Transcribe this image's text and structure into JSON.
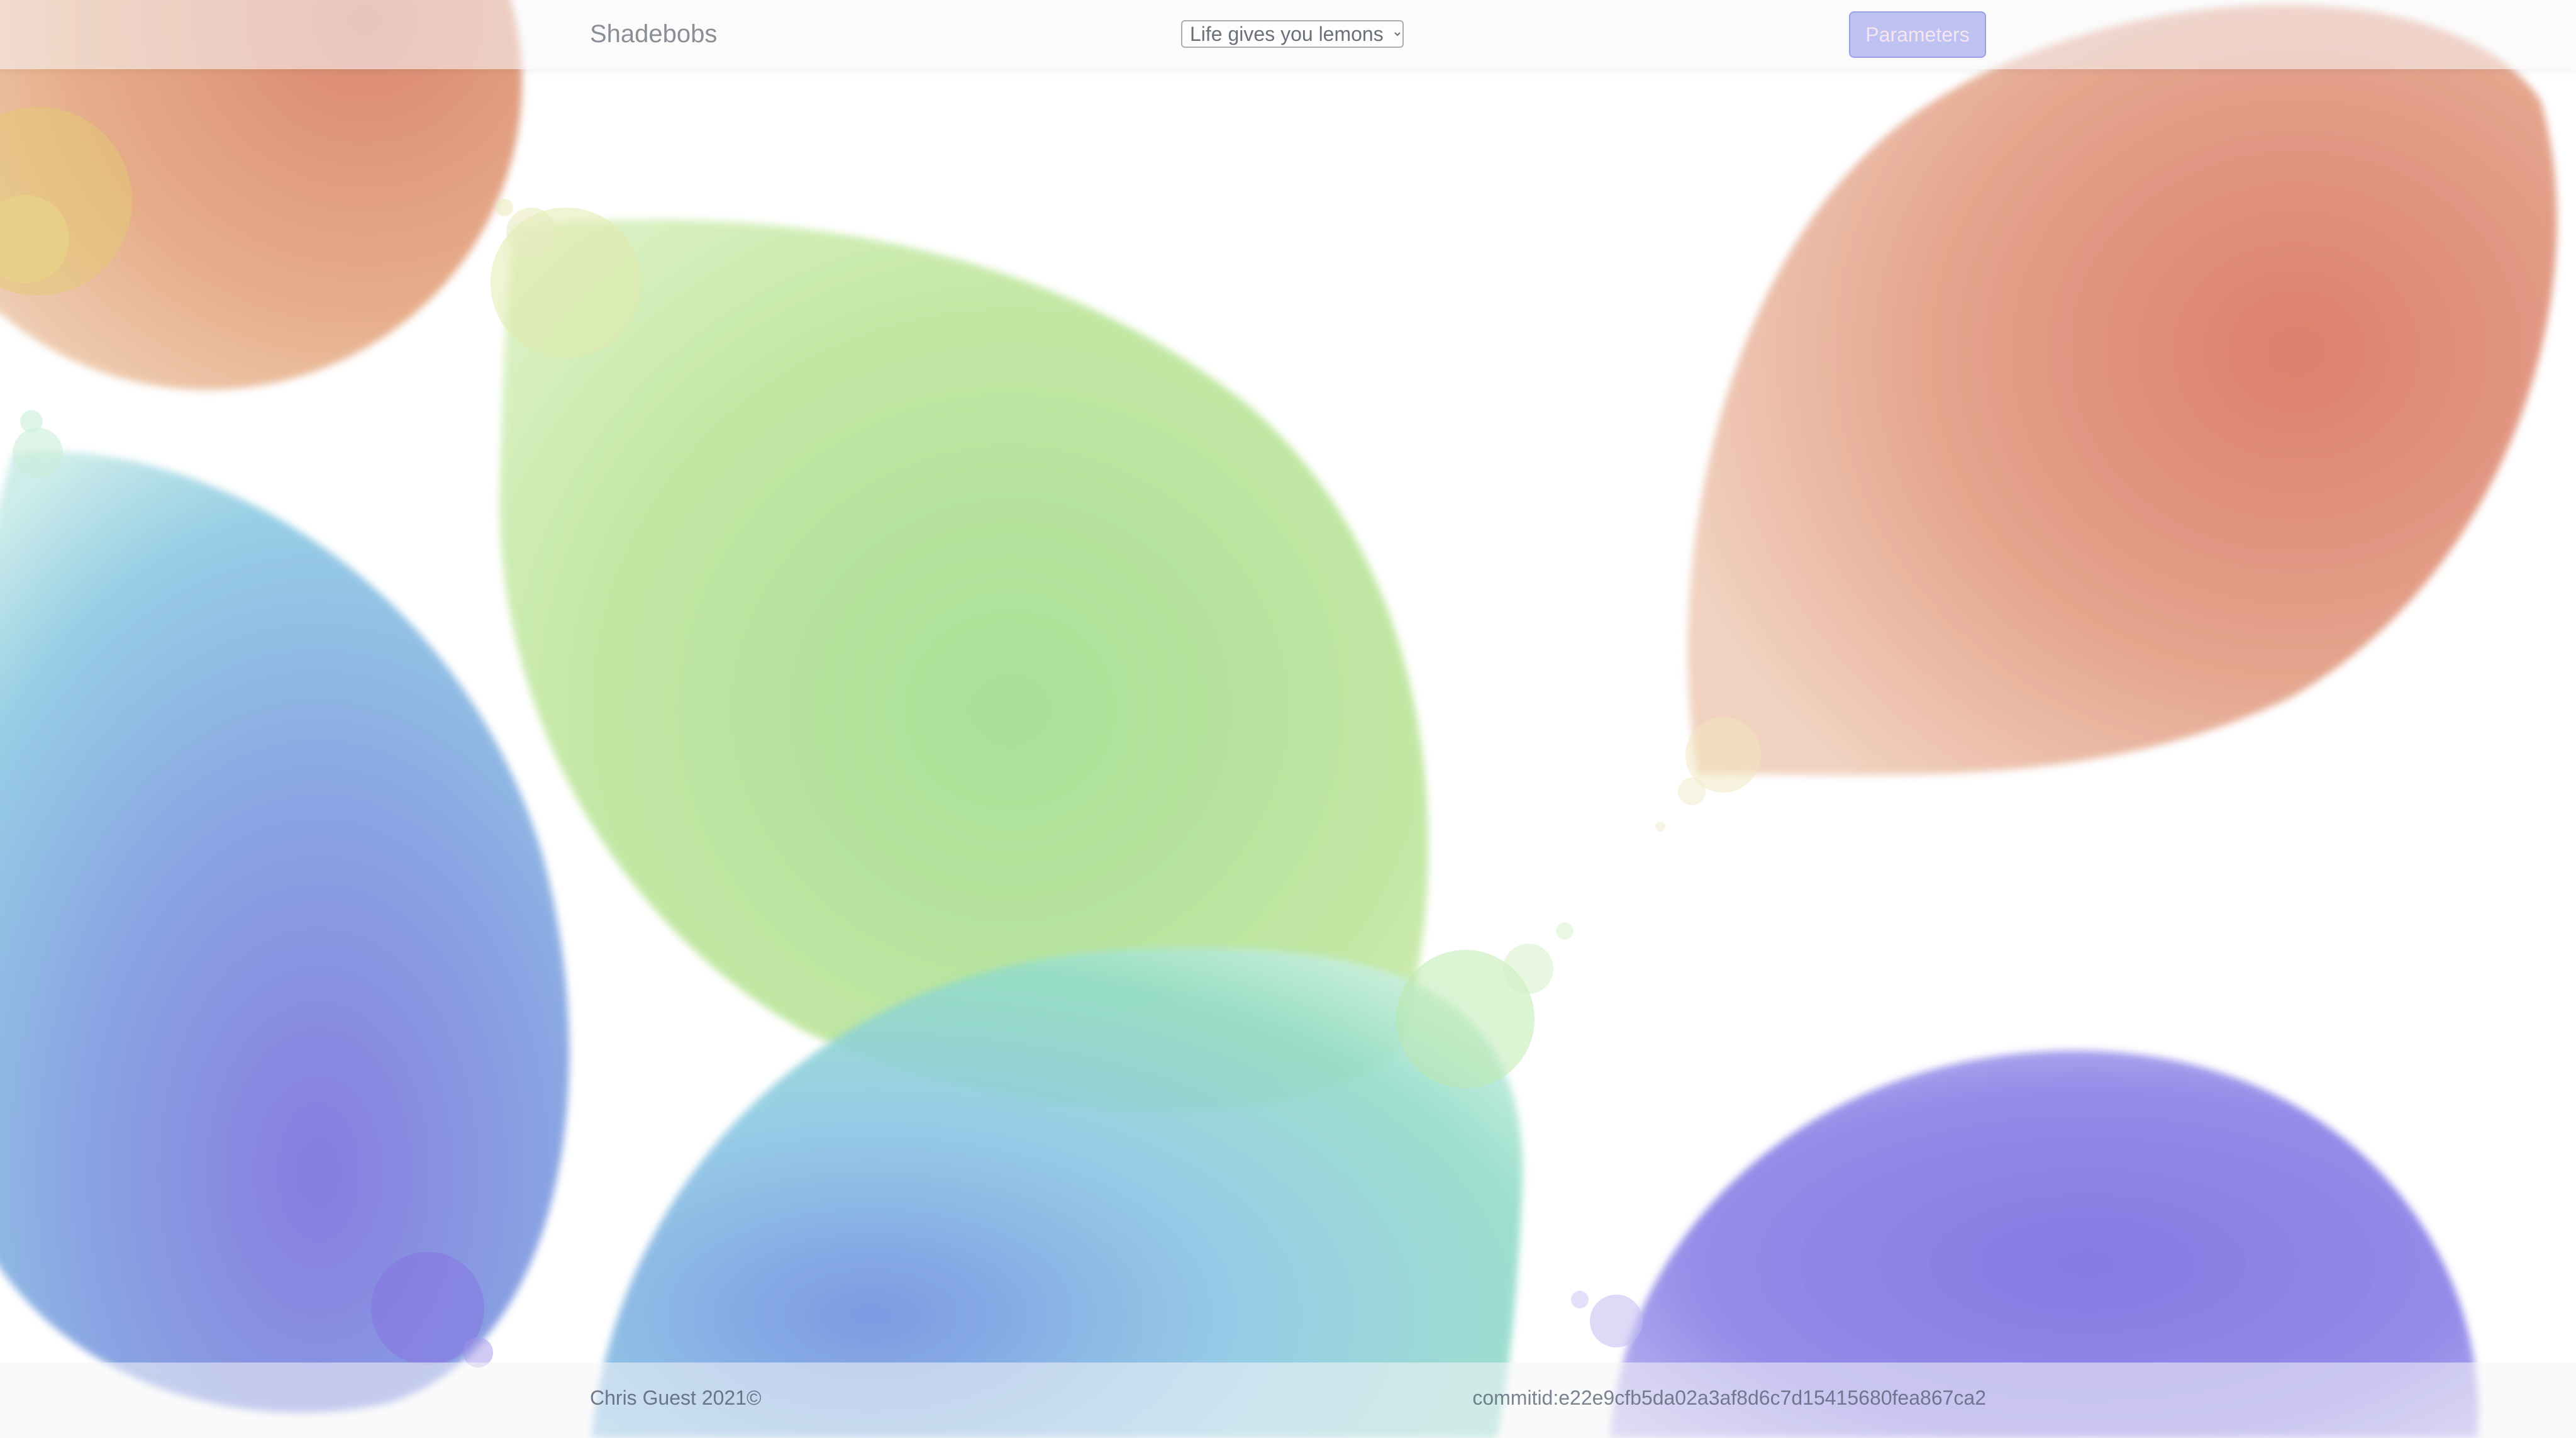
{
  "app": {
    "brand": "Shadebobs"
  },
  "toolbar": {
    "preset_selected": "Life gives you lemons",
    "preset_options": [
      "Life gives you lemons"
    ],
    "parameters_label": "Parameters"
  },
  "footer": {
    "copyright": "Chris Guest 2021©",
    "commit": "commitid:e22e9cfb5da02a3af8d6c7d15415680fea867ca2"
  }
}
